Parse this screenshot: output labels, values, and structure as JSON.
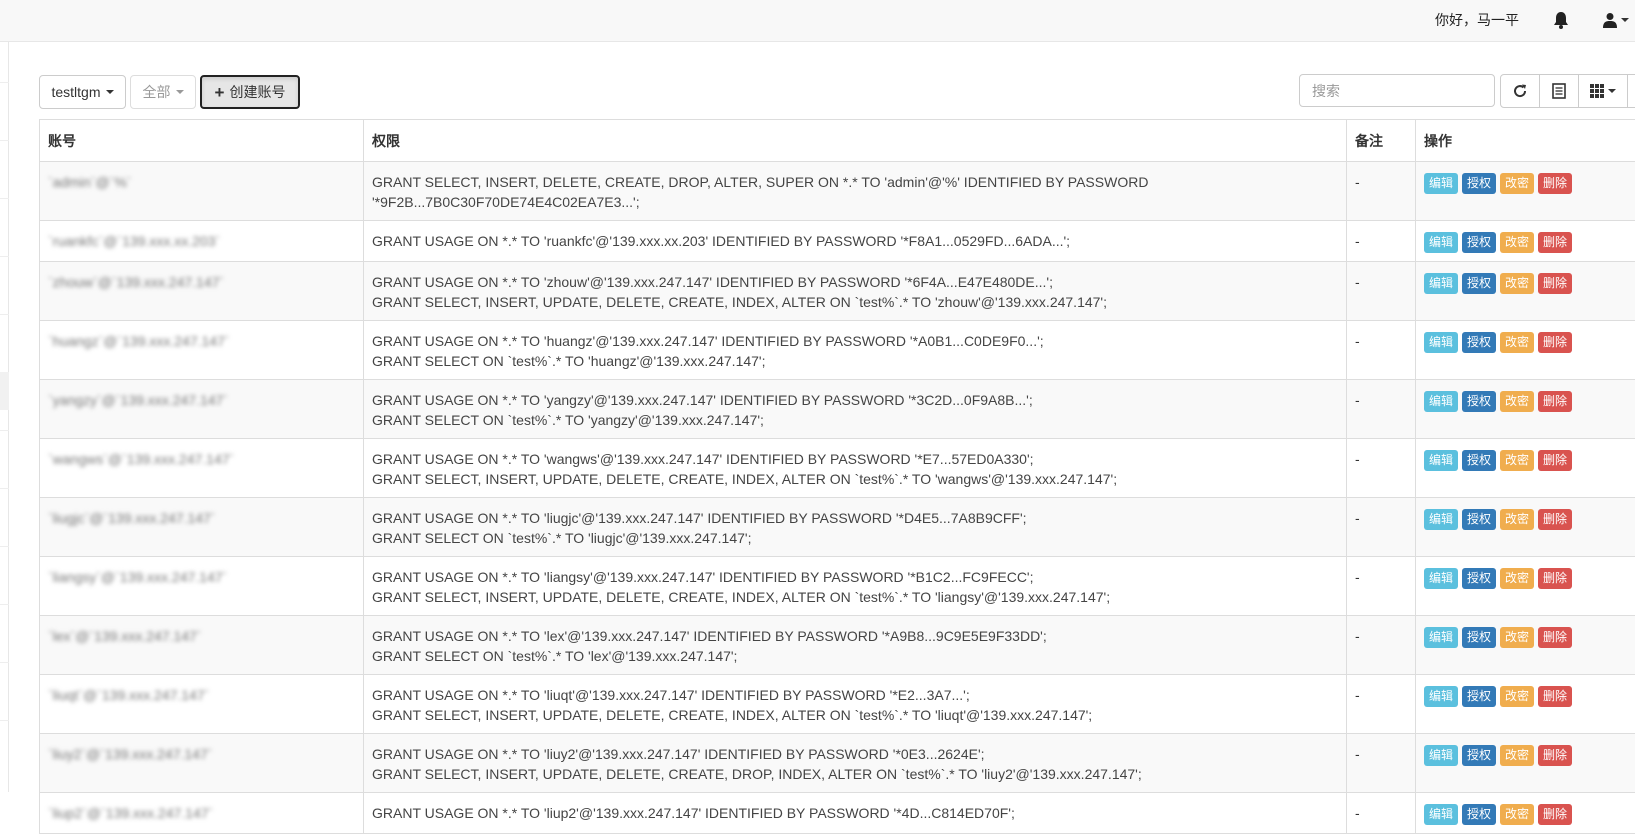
{
  "header": {
    "greeting": "你好，马一平"
  },
  "toolbar": {
    "instance_label": "testltgm",
    "filter_label": "全部",
    "create_label": "创建账号",
    "search_placeholder": "搜索"
  },
  "table": {
    "columns": [
      "账号",
      "权限",
      "备注",
      "操作"
    ],
    "actions": [
      "编辑",
      "授权",
      "改密",
      "删除"
    ],
    "rows": [
      {
        "account": "`admin`@`%`",
        "perm1": "GRANT SELECT, INSERT, DELETE, CREATE, DROP, ALTER, SUPER ON *.* TO 'admin'@'%' IDENTIFIED BY PASSWORD",
        "perm2": "'*9F2B...7B0C30F70DE74E4C02EA7E3...';",
        "note": "-"
      },
      {
        "account": "`ruankfc`@`139.xxx.xx.203`",
        "perm1": "GRANT USAGE ON *.* TO 'ruankfc'@'139.xxx.xx.203' IDENTIFIED BY PASSWORD '*F8A1...0529FD...6ADA...';",
        "perm2": "",
        "note": "-"
      },
      {
        "account": "`zhouw`@`139.xxx.247.147`",
        "perm1": "GRANT USAGE ON *.* TO 'zhouw'@'139.xxx.247.147' IDENTIFIED BY PASSWORD '*6F4A...E47E480DE...';",
        "perm2": "GRANT SELECT, INSERT, UPDATE, DELETE, CREATE, INDEX, ALTER ON `test%`.* TO 'zhouw'@'139.xxx.247.147';",
        "note": "-"
      },
      {
        "account": "`huangz`@`139.xxx.247.147`",
        "perm1": "GRANT USAGE ON *.* TO 'huangz'@'139.xxx.247.147' IDENTIFIED BY PASSWORD '*A0B1...C0DE9F0...';",
        "perm2": "GRANT SELECT ON `test%`.* TO 'huangz'@'139.xxx.247.147';",
        "note": "-"
      },
      {
        "account": "`yangzy`@`139.xxx.247.147`",
        "perm1": "GRANT USAGE ON *.* TO 'yangzy'@'139.xxx.247.147' IDENTIFIED BY PASSWORD '*3C2D...0F9A8B...';",
        "perm2": "GRANT SELECT ON `test%`.* TO 'yangzy'@'139.xxx.247.147';",
        "note": "-"
      },
      {
        "account": "`wangws`@`139.xxx.247.147`",
        "perm1": "GRANT USAGE ON *.* TO 'wangws'@'139.xxx.247.147' IDENTIFIED BY PASSWORD '*E7...57ED0A330';",
        "perm2": "GRANT SELECT, INSERT, UPDATE, DELETE, CREATE, INDEX, ALTER ON `test%`.* TO 'wangws'@'139.xxx.247.147';",
        "note": "-"
      },
      {
        "account": "`liugjc`@`139.xxx.247.147`",
        "perm1": "GRANT USAGE ON *.* TO 'liugjc'@'139.xxx.247.147' IDENTIFIED BY PASSWORD '*D4E5...7A8B9CFF';",
        "perm2": "GRANT SELECT ON `test%`.* TO 'liugjc'@'139.xxx.247.147';",
        "note": "-"
      },
      {
        "account": "`liangsy`@`139.xxx.247.147`",
        "perm1": "GRANT USAGE ON *.* TO 'liangsy'@'139.xxx.247.147' IDENTIFIED BY PASSWORD '*B1C2...FC9FECC';",
        "perm2": "GRANT SELECT, INSERT, UPDATE, DELETE, CREATE, INDEX, ALTER ON `test%`.* TO 'liangsy'@'139.xxx.247.147';",
        "note": "-"
      },
      {
        "account": "`lex`@`139.xxx.247.147`",
        "perm1": "GRANT USAGE ON *.* TO 'lex'@'139.xxx.247.147' IDENTIFIED BY PASSWORD '*A9B8...9C9E5E9F33DD';",
        "perm2": "GRANT SELECT ON `test%`.* TO 'lex'@'139.xxx.247.147';",
        "note": "-"
      },
      {
        "account": "`liuqt`@`139.xxx.247.147`",
        "perm1": "GRANT USAGE ON *.* TO 'liuqt'@'139.xxx.247.147' IDENTIFIED BY PASSWORD '*E2...3A7...';",
        "perm2": "GRANT SELECT, INSERT, UPDATE, DELETE, CREATE, INDEX, ALTER ON `test%`.* TO 'liuqt'@'139.xxx.247.147';",
        "note": "-"
      },
      {
        "account": "`liuy2`@`139.xxx.247.147`",
        "perm1": "GRANT USAGE ON *.* TO 'liuy2'@'139.xxx.247.147' IDENTIFIED BY PASSWORD '*0E3...2624E';",
        "perm2": "GRANT SELECT, INSERT, UPDATE, DELETE, CREATE, DROP, INDEX, ALTER ON `test%`.* TO 'liuy2'@'139.xxx.247.147';",
        "note": "-"
      },
      {
        "account": "`liup2`@`139.xxx.247.147`",
        "perm1": "GRANT USAGE ON *.* TO 'liup2'@'139.xxx.247.147' IDENTIFIED BY PASSWORD '*4D...C814ED70F';",
        "perm2": "",
        "note": "-"
      }
    ]
  }
}
